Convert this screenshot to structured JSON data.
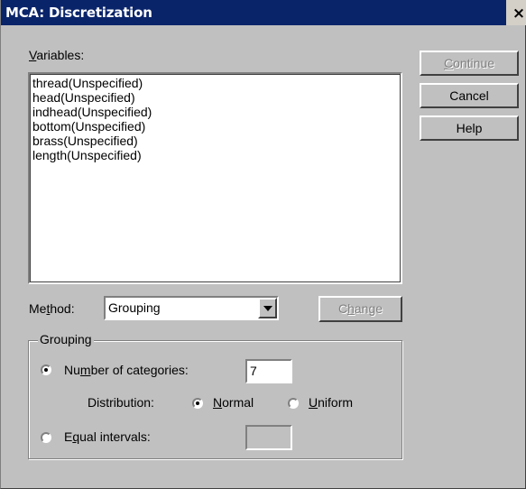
{
  "window": {
    "title": "MCA: Discretization",
    "close_label": "×"
  },
  "variables": {
    "label_first": "V",
    "label_rest": "ariables:",
    "items": [
      "thread(Unspecified)",
      "head(Unspecified)",
      "indhead(Unspecified)",
      "bottom(Unspecified)",
      "brass(Unspecified)",
      "length(Unspecified)"
    ]
  },
  "buttons": {
    "continue_first": "C",
    "continue_rest": "ontinue",
    "cancel": "Cancel",
    "help": "Help",
    "change_pre": "C",
    "change_u": "h",
    "change_rest": "ange"
  },
  "method": {
    "label_pre": "Me",
    "label_u": "t",
    "label_rest": "hod:",
    "selected": "Grouping"
  },
  "grouping": {
    "legend": "Grouping",
    "num_categories_pre": "Nu",
    "num_categories_u": "m",
    "num_categories_rest": "ber of categories:",
    "num_categories_value": "7",
    "num_categories_selected": true,
    "distribution_label": "Distribution:",
    "normal_u": "N",
    "normal_rest": "ormal",
    "normal_selected": true,
    "uniform_u": "U",
    "uniform_rest": "niform",
    "uniform_selected": false,
    "equal_intervals_pre": "E",
    "equal_intervals_u": "q",
    "equal_intervals_rest": "ual intervals:",
    "equal_intervals_selected": false,
    "equal_intervals_value": ""
  }
}
